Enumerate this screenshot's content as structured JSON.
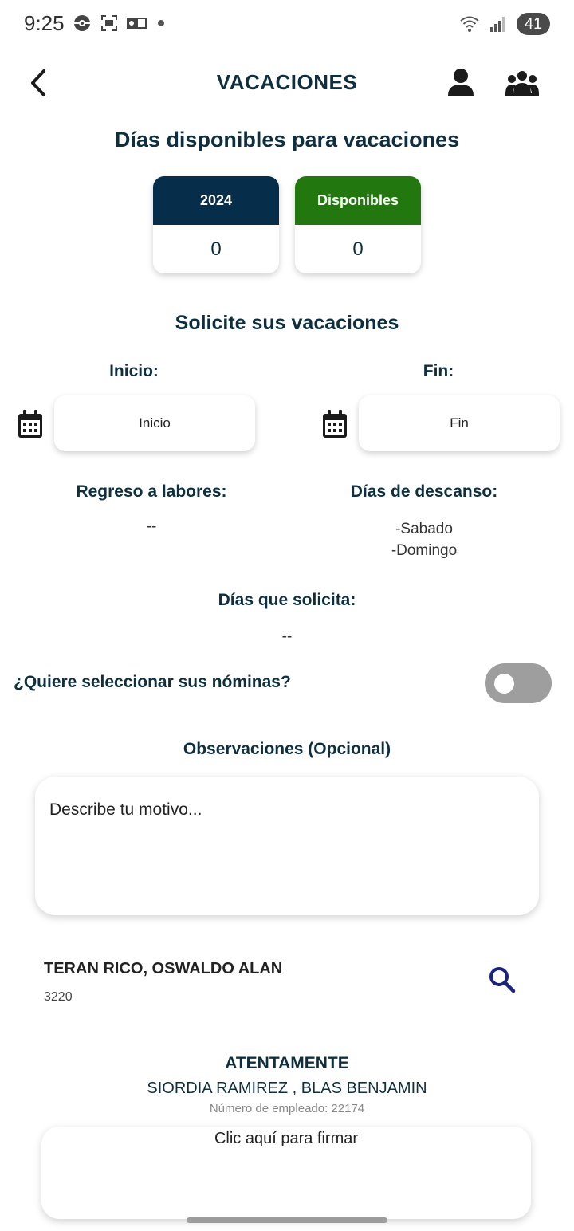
{
  "status_bar": {
    "time": "9:25",
    "battery": "41"
  },
  "header": {
    "title": "VACACIONES",
    "back_icon": "chevron-left-icon",
    "profile_icon": "person-icon",
    "team_icon": "group-icon"
  },
  "available": {
    "heading": "Días disponibles para vacaciones",
    "year_label": "2024",
    "year_value": "0",
    "available_label": "Disponibles",
    "available_value": "0",
    "year_color": "#062d4a",
    "available_color": "#23770f"
  },
  "request": {
    "heading": "Solicite sus vacaciones",
    "start_label": "Inicio:",
    "start_placeholder": "Inicio",
    "end_label": "Fin:",
    "end_placeholder": "Fin",
    "return_label": "Regreso a labores:",
    "return_value": "--",
    "rest_label": "Días de descanso:",
    "rest_days": [
      "-Sabado",
      "-Domingo"
    ],
    "days_label": "Días que solicita:",
    "days_value": "--"
  },
  "payroll": {
    "question": "¿Quiere seleccionar sus nóminas?",
    "enabled": false
  },
  "observations": {
    "label": "Observaciones (Opcional)",
    "placeholder": "Describe tu motivo..."
  },
  "employee": {
    "name": "TERAN RICO, OSWALDO ALAN",
    "number": "3220",
    "search_icon": "search-icon"
  },
  "signature": {
    "closing": "ATENTAMENTE",
    "name": "SIORDIA  RAMIREZ , BLAS BENJAMIN",
    "employee_number": "Número de empleado: 22174",
    "sign_prompt": "Clic aquí para firmar"
  }
}
